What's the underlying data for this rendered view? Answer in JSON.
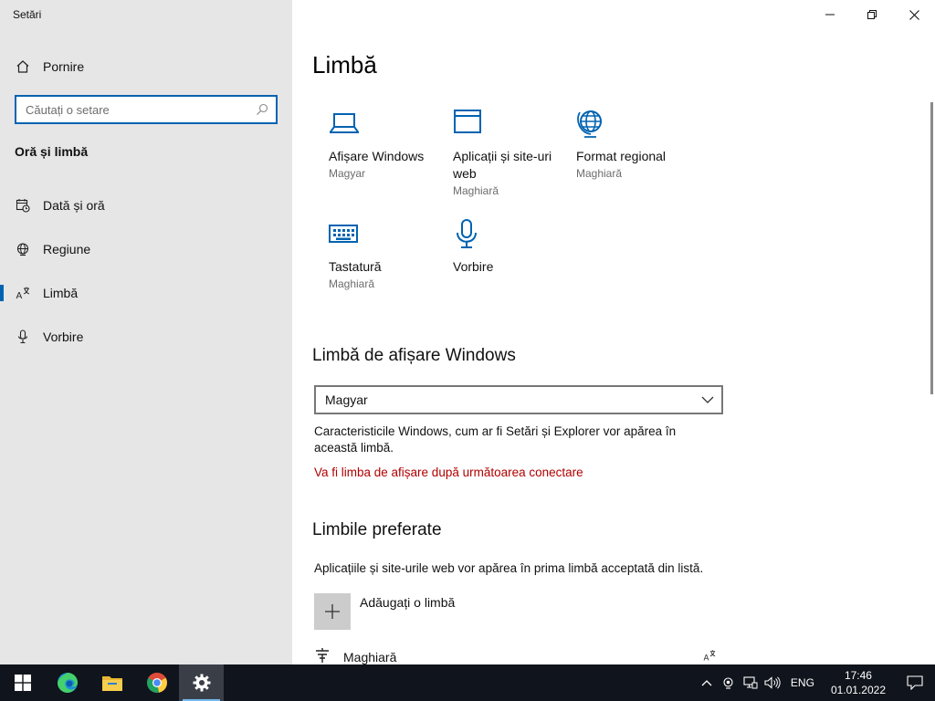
{
  "app": {
    "title": "Setări"
  },
  "sidebar": {
    "home_label": "Pornire",
    "search_placeholder": "Căutați o setare",
    "section_title": "Oră și limbă",
    "items": [
      {
        "label": "Dată și oră",
        "icon": "calendar-clock-icon"
      },
      {
        "label": "Regiune",
        "icon": "globe-icon"
      },
      {
        "label": "Limbă",
        "icon": "language-icon",
        "active": true
      },
      {
        "label": "Vorbire",
        "icon": "microphone-icon"
      }
    ]
  },
  "main": {
    "title": "Limbă",
    "tiles": [
      {
        "title": "Afișare Windows",
        "subtitle": "Magyar",
        "icon": "laptop-icon"
      },
      {
        "title": "Aplicații și site-uri web",
        "subtitle": "Maghiară",
        "icon": "window-icon"
      },
      {
        "title": "Format regional",
        "subtitle": "Maghiară",
        "icon": "globe-icon"
      },
      {
        "title": "Tastatură",
        "subtitle": "Maghiară",
        "icon": "keyboard-icon"
      },
      {
        "title": "Vorbire",
        "subtitle": "",
        "icon": "microphone-icon"
      }
    ],
    "display_language": {
      "heading": "Limbă de afișare Windows",
      "selected": "Magyar",
      "description": "Caracteristicile Windows, cum ar fi Setări și Explorer vor apărea în această limbă.",
      "notice": "Va fi limba de afișare după următoarea conectare"
    },
    "preferred": {
      "heading": "Limbile preferate",
      "description": "Aplicațiile și site-urile web vor apărea în prima limbă acceptată din listă.",
      "add_label": "Adăugați o limbă",
      "languages": [
        {
          "name": "Maghiară"
        }
      ]
    }
  },
  "taskbar": {
    "apps": [
      "windows-start-icon",
      "edge-icon",
      "file-explorer-icon",
      "chrome-icon",
      "settings-icon"
    ],
    "input_language": "ENG",
    "time": "17:46",
    "date": "01.01.2022"
  },
  "colors": {
    "accent": "#0063b1",
    "notice": "#b00000",
    "sidebar_bg": "#e6e6e6",
    "taskbar_bg": "#10141c"
  }
}
